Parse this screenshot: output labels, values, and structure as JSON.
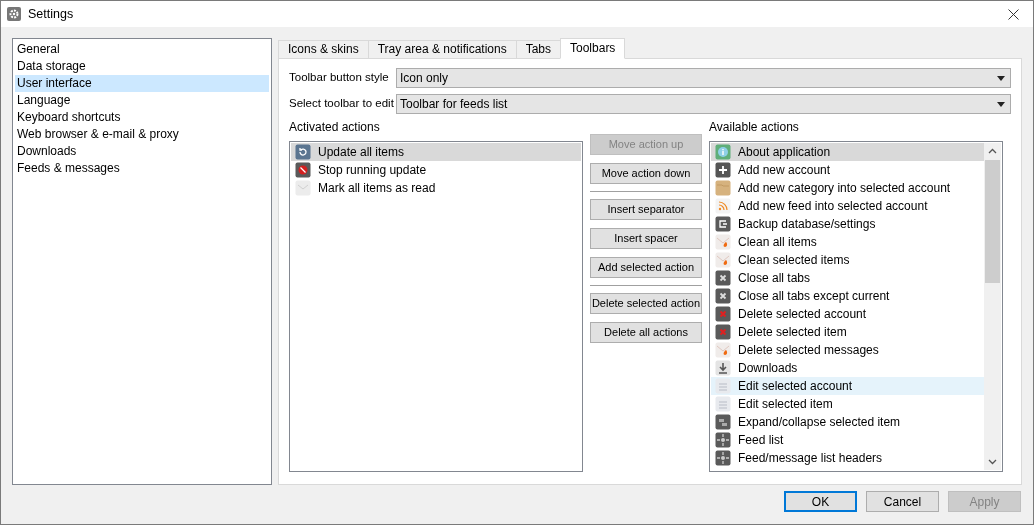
{
  "window": {
    "title": "Settings"
  },
  "sidebar": {
    "items": [
      {
        "label": "General",
        "selected": false
      },
      {
        "label": "Data storage",
        "selected": false
      },
      {
        "label": "User interface",
        "selected": true
      },
      {
        "label": "Language",
        "selected": false
      },
      {
        "label": "Keyboard shortcuts",
        "selected": false
      },
      {
        "label": "Web browser & e-mail & proxy",
        "selected": false
      },
      {
        "label": "Downloads",
        "selected": false
      },
      {
        "label": "Feeds & messages",
        "selected": false
      }
    ]
  },
  "tabs": [
    {
      "label": "Icons & skins",
      "selected": false
    },
    {
      "label": "Tray area & notifications",
      "selected": false
    },
    {
      "label": "Tabs",
      "selected": false
    },
    {
      "label": "Toolbars",
      "selected": true
    }
  ],
  "fields": [
    {
      "label": "Toolbar button style",
      "value": "Icon only"
    },
    {
      "label": "Select toolbar to edit",
      "value": "Toolbar for feeds list"
    }
  ],
  "activated": {
    "title": "Activated actions",
    "items": [
      {
        "label": "Update all items",
        "kind": "refresh",
        "selected": true
      },
      {
        "label": "Stop running update",
        "kind": "stop",
        "selected": false
      },
      {
        "label": "Mark all items as read",
        "kind": "mail",
        "selected": false
      }
    ]
  },
  "action_buttons": [
    {
      "label": "Move action up",
      "disabled": true,
      "separator_before": false
    },
    {
      "label": "Move action down",
      "disabled": false,
      "separator_before": false
    },
    {
      "label": "Insert separator",
      "disabled": false,
      "separator_before": true
    },
    {
      "label": "Insert spacer",
      "disabled": false,
      "separator_before": false
    },
    {
      "label": "Add selected action",
      "disabled": false,
      "separator_before": false
    },
    {
      "label": "Delete selected action",
      "disabled": false,
      "separator_before": true
    },
    {
      "label": "Delete all actions",
      "disabled": false,
      "separator_before": false
    }
  ],
  "available": {
    "title": "Available actions",
    "items": [
      {
        "label": "About application",
        "kind": "info",
        "selected": true,
        "hovered": false
      },
      {
        "label": "Add new account",
        "kind": "plus",
        "selected": false,
        "hovered": false
      },
      {
        "label": "Add new category into selected account",
        "kind": "folder",
        "selected": false,
        "hovered": false
      },
      {
        "label": "Add new feed into selected account",
        "kind": "rss",
        "selected": false,
        "hovered": false
      },
      {
        "label": "Backup database/settings",
        "kind": "backup",
        "selected": false,
        "hovered": false
      },
      {
        "label": "Clean all items",
        "kind": "clean",
        "selected": false,
        "hovered": false
      },
      {
        "label": "Clean selected items",
        "kind": "clean",
        "selected": false,
        "hovered": false
      },
      {
        "label": "Close all tabs",
        "kind": "close",
        "selected": false,
        "hovered": false
      },
      {
        "label": "Close all tabs except current",
        "kind": "close",
        "selected": false,
        "hovered": false
      },
      {
        "label": "Delete selected account",
        "kind": "delete",
        "selected": false,
        "hovered": false
      },
      {
        "label": "Delete selected item",
        "kind": "delete",
        "selected": false,
        "hovered": false
      },
      {
        "label": "Delete selected messages",
        "kind": "clean",
        "selected": false,
        "hovered": false
      },
      {
        "label": "Downloads",
        "kind": "download",
        "selected": false,
        "hovered": false
      },
      {
        "label": "Edit selected account",
        "kind": "edit",
        "selected": false,
        "hovered": true
      },
      {
        "label": "Edit selected item",
        "kind": "edit",
        "selected": false,
        "hovered": false
      },
      {
        "label": "Expand/collapse selected item",
        "kind": "expand",
        "selected": false,
        "hovered": false
      },
      {
        "label": "Feed list",
        "kind": "move",
        "selected": false,
        "hovered": false
      },
      {
        "label": "Feed/message list headers",
        "kind": "move",
        "selected": false,
        "hovered": false
      }
    ]
  },
  "dialog_buttons": [
    {
      "label": "OK",
      "default": true,
      "disabled": false
    },
    {
      "label": "Cancel",
      "default": false,
      "disabled": false
    },
    {
      "label": "Apply",
      "default": false,
      "disabled": true
    }
  ]
}
